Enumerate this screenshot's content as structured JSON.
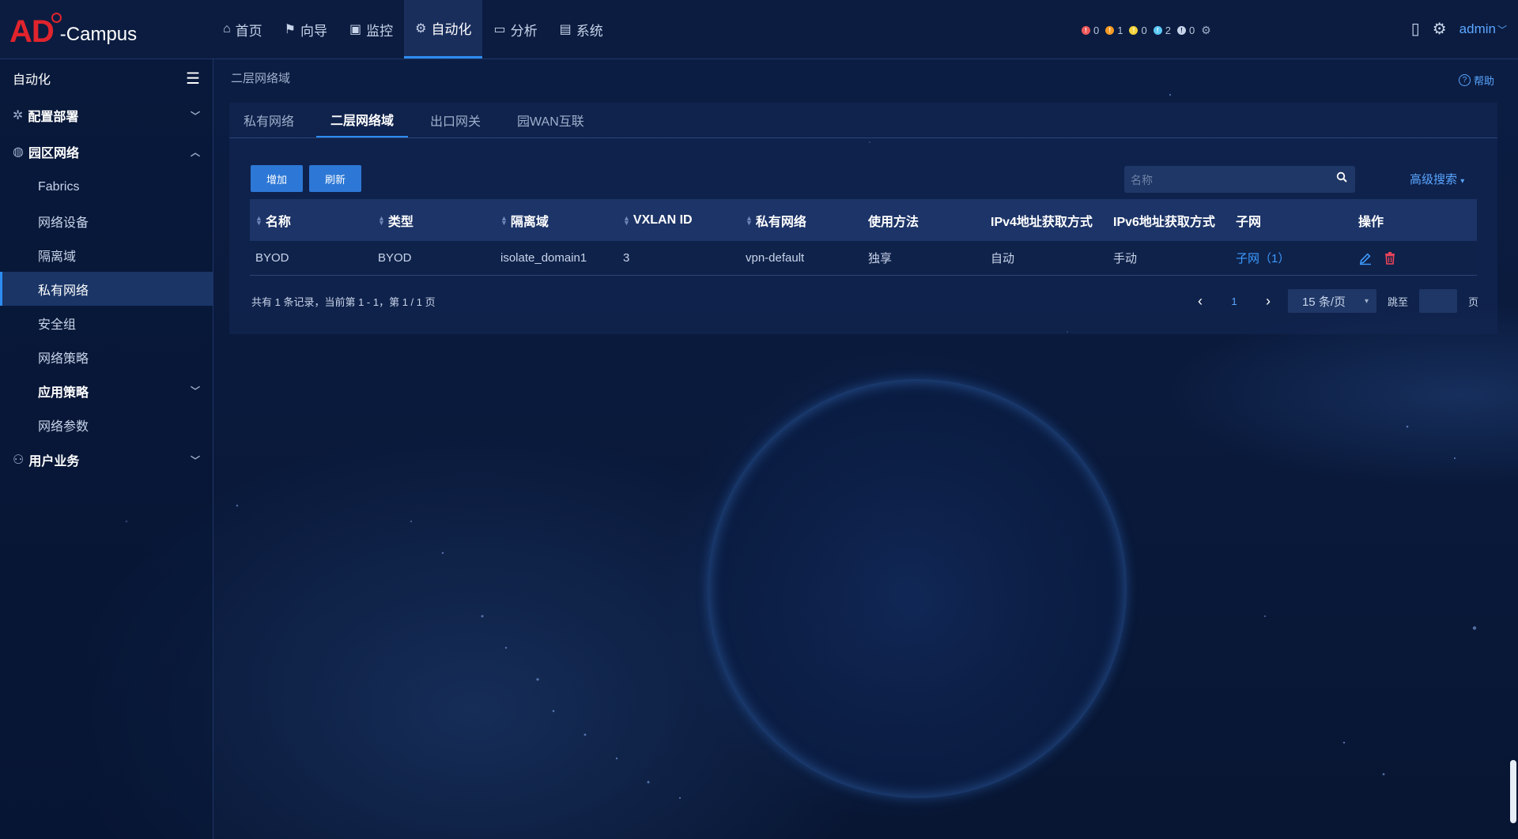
{
  "app": {
    "logo_ad": "AD",
    "logo_campus": "-Campus"
  },
  "nav": [
    {
      "label": "首页",
      "icon": "home-icon"
    },
    {
      "label": "向导",
      "icon": "guide-icon"
    },
    {
      "label": "监控",
      "icon": "monitor-icon"
    },
    {
      "label": "自动化",
      "icon": "automation-icon",
      "active": true
    },
    {
      "label": "分析",
      "icon": "analysis-icon"
    },
    {
      "label": "系统",
      "icon": "system-icon"
    }
  ],
  "alarms": [
    {
      "count": "0",
      "color": "#f05a5a"
    },
    {
      "count": "1",
      "color": "#f59a23"
    },
    {
      "count": "0",
      "color": "#f5d33b"
    },
    {
      "count": "2",
      "color": "#5bc8f5"
    },
    {
      "count": "0",
      "color": "#c8d4ea"
    }
  ],
  "header": {
    "user": "admin"
  },
  "sidebar": {
    "title": "自动化",
    "groups": [
      {
        "label": "配置部署"
      },
      {
        "label": "园区网络"
      },
      {
        "label": "用户业务"
      }
    ],
    "items": [
      {
        "label": "Fabrics"
      },
      {
        "label": "网络设备"
      },
      {
        "label": "隔离域"
      },
      {
        "label": "私有网络"
      },
      {
        "label": "安全组"
      },
      {
        "label": "网络策略"
      },
      {
        "label": "应用策略"
      },
      {
        "label": "网络参数"
      }
    ]
  },
  "main": {
    "breadcrumb": "二层网络域",
    "help": "帮助",
    "tabs": [
      "私有网络",
      "二层网络域",
      "出口网关",
      "园WAN互联"
    ],
    "add_label": "增加",
    "refresh_label": "刷新",
    "search_placeholder": "名称",
    "advanced_search": "高级搜索",
    "columns": [
      "名称",
      "类型",
      "隔离域",
      "VXLAN ID",
      "私有网络",
      "使用方法",
      "IPv4地址获取方式",
      "IPv6地址获取方式",
      "子网",
      "操作"
    ],
    "rows": [
      {
        "name": "BYOD",
        "type": "BYOD",
        "isolation": "isolate_domain1",
        "vxlan": "3",
        "private_net": "vpn-default",
        "usage": "独享",
        "ipv4": "自动",
        "ipv6": "手动",
        "subnet": "子网（1）"
      }
    ],
    "summary": "共有 1 条记录，当前第 1 - 1，第 1 / 1 页",
    "page": "1",
    "page_size": "15 条/页",
    "jump_label": "跳至",
    "page_unit": "页"
  }
}
